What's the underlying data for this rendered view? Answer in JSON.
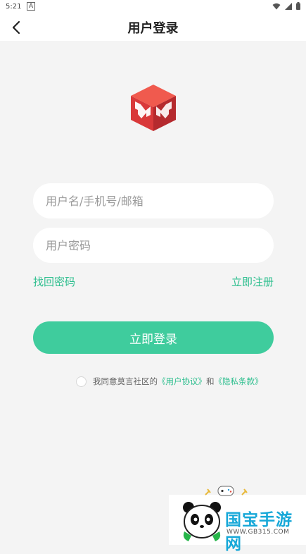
{
  "status_bar": {
    "time": "5:21",
    "notification": "A"
  },
  "header": {
    "title": "用户登录"
  },
  "form": {
    "username_placeholder": "用户名/手机号/邮箱",
    "password_placeholder": "用户密码",
    "forgot_password": "找回密码",
    "register": "立即注册",
    "login_button": "立即登录"
  },
  "agreement": {
    "prefix": "我同意莫言社区的",
    "user_agreement": "《用户协议》",
    "and": "和",
    "privacy_policy": "《隐私条款》"
  },
  "watermark": {
    "title": "国宝手游网",
    "url": "WWW.GB315.COM"
  },
  "colors": {
    "accent": "#3fcc9d",
    "link": "#2fbf8f",
    "logo_red": "#d9393a",
    "background": "#f4f4f4"
  },
  "icons": [
    "back-arrow-icon",
    "wifi-icon",
    "signal-icon",
    "battery-icon",
    "app-logo-cube-icon",
    "panda-mascot-icon"
  ]
}
